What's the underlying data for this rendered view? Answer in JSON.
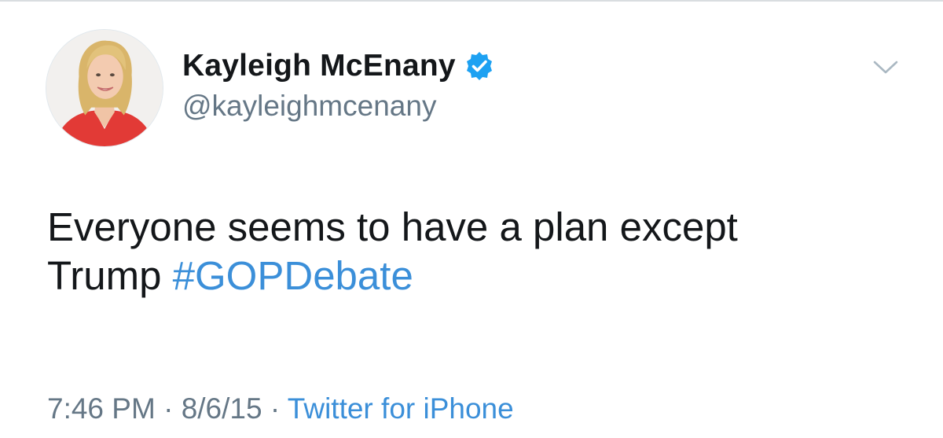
{
  "user": {
    "display_name": "Kayleigh McEnany",
    "handle": "@kayleighmcenany",
    "verified_icon": "verified-badge-icon",
    "avatar_icon": "profile-photo"
  },
  "tweet": {
    "text_line1": "Everyone seems to have a plan except",
    "text_word": "Trump",
    "hashtag": "#GOPDebate"
  },
  "meta": {
    "time": "7:46 PM",
    "separator": "·",
    "date": "8/6/15",
    "source": "Twitter for iPhone"
  },
  "colors": {
    "accent": "#3b8fd9",
    "verified": "#1da1f2",
    "text": "#14171a",
    "muted": "#657786"
  },
  "menu": {
    "icon": "chevron-down-icon"
  }
}
